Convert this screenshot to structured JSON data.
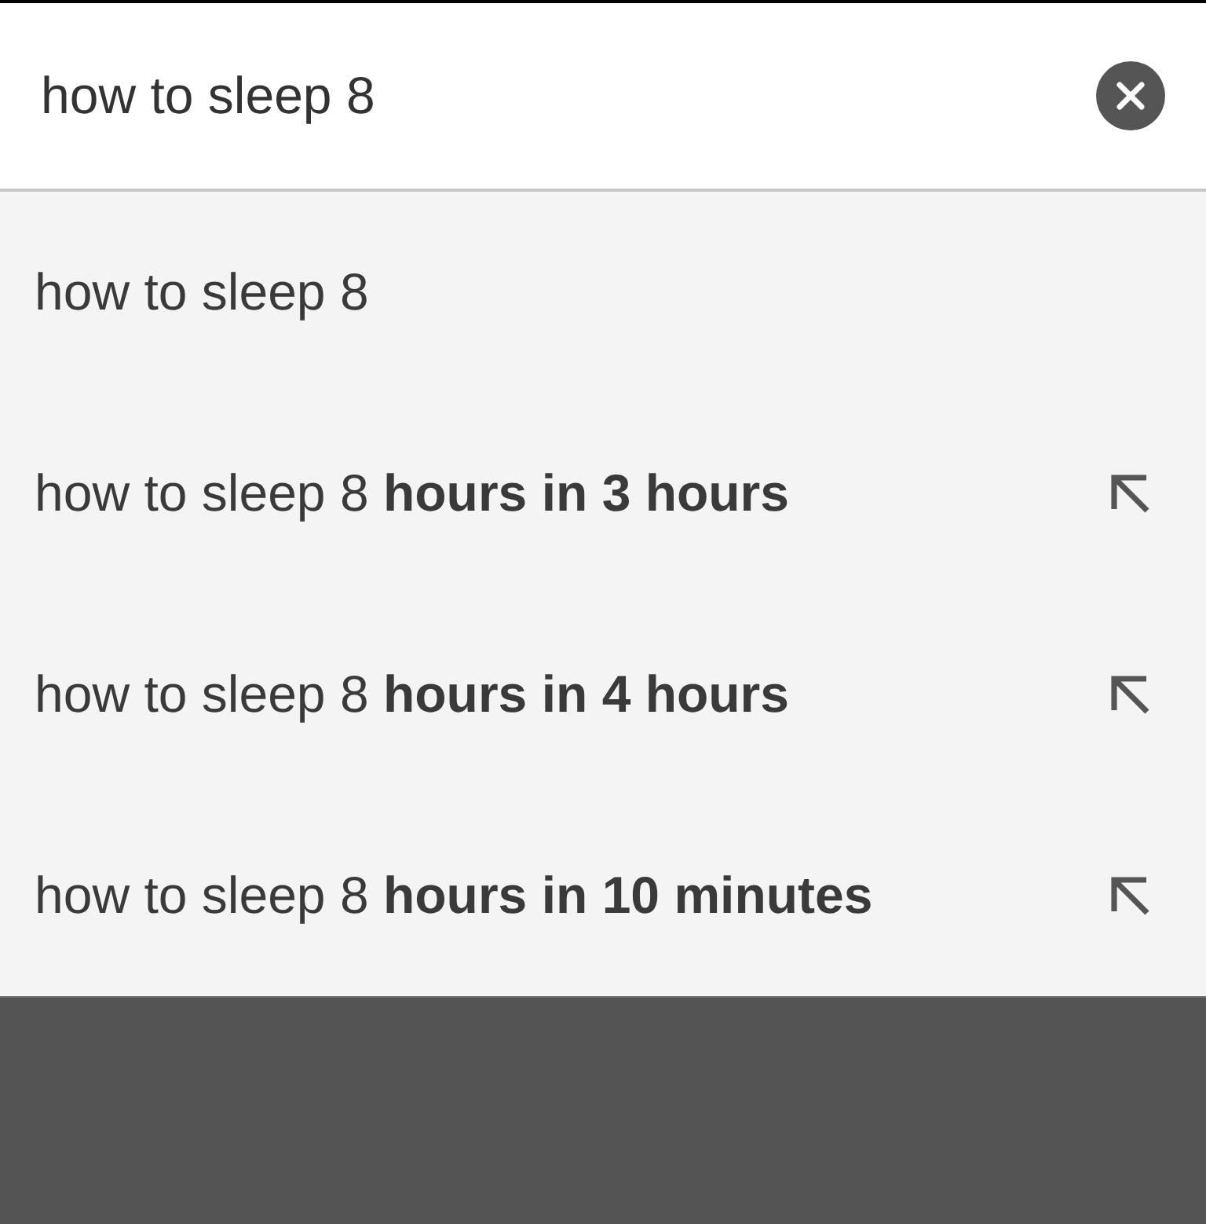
{
  "search": {
    "value": "how to sleep 8"
  },
  "suggestions": [
    {
      "text": "how to sleep 8",
      "kind": "query"
    },
    {
      "text": "how to sleep 8 **hours in 3 hours**",
      "kind": "completion"
    },
    {
      "text": "how to sleep 8 **hours in 4 hours**",
      "kind": "completion"
    },
    {
      "text": "how to sleep 8 **hours in 10 minutes**",
      "kind": "completion"
    }
  ]
}
